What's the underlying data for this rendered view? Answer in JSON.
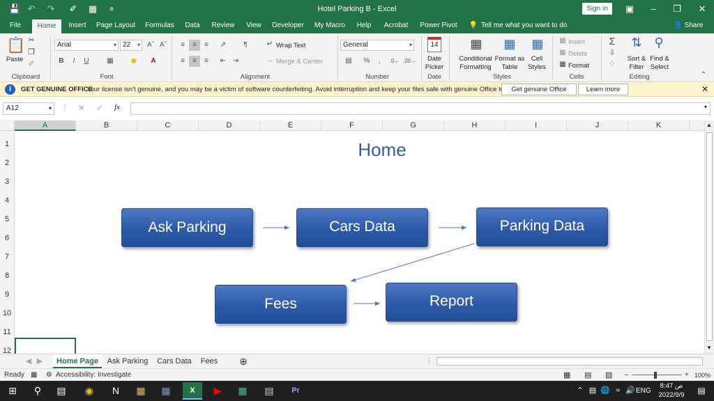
{
  "window": {
    "title": "Hotel Parking B  -  Excel",
    "sign_in": "Sign in"
  },
  "tabs": [
    "File",
    "Home",
    "Insert",
    "Page Layout",
    "Formulas",
    "Data",
    "Review",
    "View",
    "Developer",
    "My Macro",
    "Help",
    "Acrobat",
    "Power Pivot"
  ],
  "active_tab": "Home",
  "tell_me": "Tell me what you want to do",
  "share": "Share",
  "ribbon": {
    "clipboard": {
      "paste": "Paste",
      "label": "Clipboard"
    },
    "font": {
      "name": "Arial",
      "size": "22",
      "bold": "B",
      "italic": "I",
      "underline": "U",
      "label": "Font"
    },
    "alignment": {
      "wrap": "Wrap Text",
      "merge": "Merge & Center",
      "label": "Alignment"
    },
    "number": {
      "format": "General",
      "percent": "%",
      "comma": ",",
      "label": "Number"
    },
    "date": {
      "day": "14",
      "btn1": "Date",
      "btn2": "Picker",
      "label": "Date"
    },
    "styles": {
      "cf1": "Conditional",
      "cf2": "Formatting",
      "ft1": "Format as",
      "ft2": "Table",
      "cs1": "Cell",
      "cs2": "Styles",
      "label": "Styles"
    },
    "cells": {
      "insert": "Insert",
      "delete": "Delete",
      "format": "Format",
      "label": "Cells"
    },
    "editing": {
      "sort1": "Sort &",
      "sort2": "Filter",
      "find1": "Find &",
      "find2": "Select",
      "label": "Editing"
    }
  },
  "infobar": {
    "title": "GET GENUINE OFFICE",
    "message": "Your license isn't genuine, and you may be a victim of software counterfeiting. Avoid interruption and keep your files safe with genuine Office today.",
    "button": "Get genuine Office",
    "learn": "Learn more"
  },
  "formula_bar": {
    "name_box": "A12",
    "fx": "fx",
    "value": ""
  },
  "columns": [
    "A",
    "B",
    "C",
    "D",
    "E",
    "F",
    "G",
    "H",
    "I",
    "J",
    "K"
  ],
  "rows": [
    "1",
    "2",
    "3",
    "4",
    "5",
    "6",
    "7",
    "8",
    "9",
    "10",
    "11",
    "12"
  ],
  "selected_cell": "A12",
  "diagram": {
    "title": "Home",
    "nodes": [
      "Ask Parking",
      "Cars Data",
      "Parking Data",
      "Fees",
      "Report"
    ],
    "edges": [
      [
        "Ask Parking",
        "Cars Data"
      ],
      [
        "Cars Data",
        "Parking Data"
      ],
      [
        "Parking Data",
        "Fees"
      ],
      [
        "Fees",
        "Report"
      ]
    ],
    "box_color": "#2d5aa8",
    "title_color": "#2e5fa5"
  },
  "sheets": [
    "Home Page",
    "Ask Parking",
    "Cars Data",
    "Fees"
  ],
  "active_sheet": "Home Page",
  "status": {
    "ready": "Ready",
    "accessibility": "Accessibility: Investigate",
    "zoom": "100%"
  },
  "taskbar": {
    "time": "8:47 ص",
    "date": "2022/9/9",
    "lang": "ENG"
  },
  "colors": {
    "excel_green": "#217346",
    "info_bg": "#fff4ce",
    "taskbar": "#1f1f1f"
  }
}
